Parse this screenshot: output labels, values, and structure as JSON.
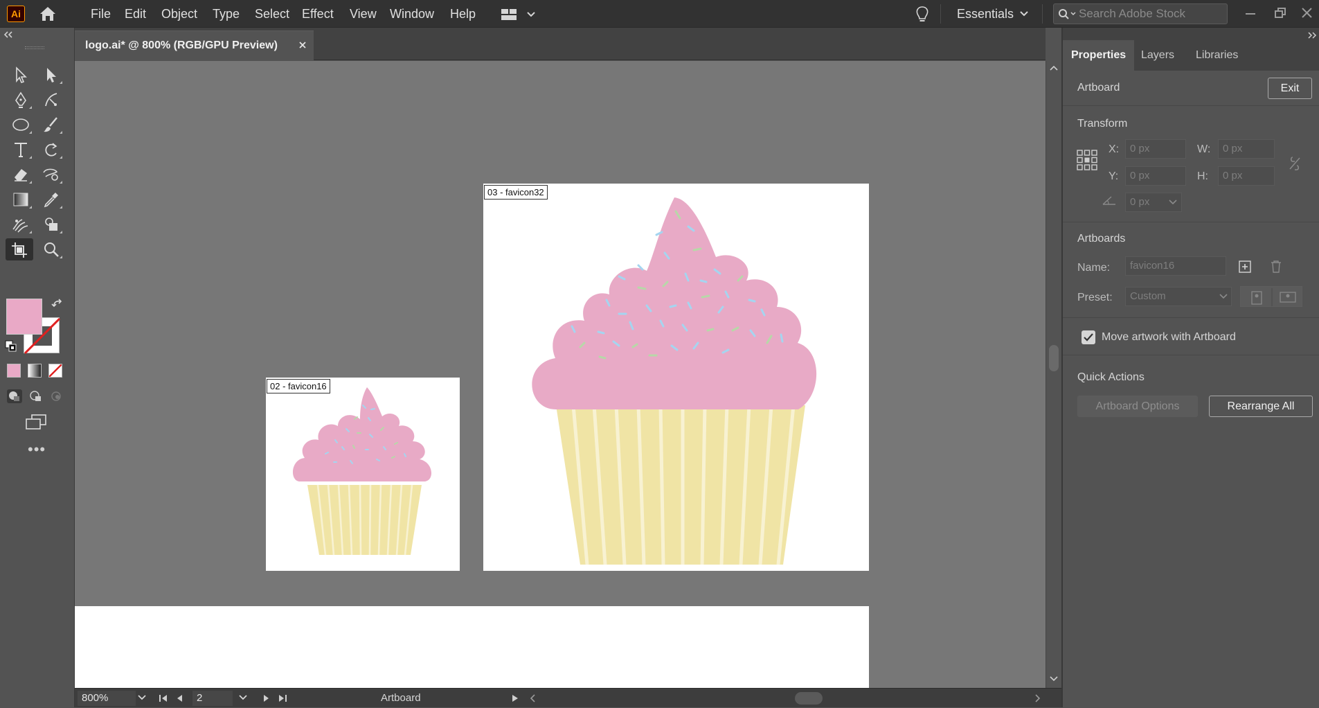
{
  "app": {
    "logo": "Ai",
    "menu": [
      "File",
      "Edit",
      "Object",
      "Type",
      "Select",
      "Effect",
      "View",
      "Window",
      "Help"
    ],
    "workspace": "Essentials",
    "stock_search_placeholder": "Search Adobe Stock"
  },
  "document": {
    "tab_title": "logo.ai* @ 800% (RGB/GPU Preview)",
    "close_glyph": "✕"
  },
  "toolbar": {
    "fill_color": "#e9a9c6",
    "stroke_color": "none",
    "more_glyph": "•••",
    "tools": [
      "selection-icon",
      "direct-selection-icon",
      "pen-icon",
      "curvature-icon",
      "ellipse-icon",
      "paintbrush-icon",
      "type-icon",
      "rotate-icon",
      "eraser-icon",
      "puppet-warp-icon",
      "gradient-icon",
      "eyedropper-icon",
      "blend-icon",
      "shape-builder-icon",
      "artboard-icon",
      "zoom-icon"
    ]
  },
  "canvas": {
    "artboards": [
      {
        "label": "02 - favicon16"
      },
      {
        "label": "03 - favicon32"
      }
    ],
    "colors": {
      "frosting": "#e8aac6",
      "wrapper": "#f0e4a5",
      "wrapper_stripe": "#f8f2d2",
      "background": "#777777"
    }
  },
  "status": {
    "zoom": "800%",
    "artboard_number": "2",
    "tool_name": "Artboard"
  },
  "panel": {
    "tabs": [
      "Properties",
      "Layers",
      "Libraries"
    ],
    "context": "Artboard",
    "exit_label": "Exit",
    "transform": {
      "title": "Transform",
      "x_label": "X:",
      "x_value": "0 px",
      "y_label": "Y:",
      "y_value": "0 px",
      "w_label": "W:",
      "w_value": "0 px",
      "h_label": "H:",
      "h_value": "0 px",
      "angle_value": "0 px"
    },
    "artboards": {
      "title": "Artboards",
      "name_label": "Name:",
      "name_value": "favicon16",
      "preset_label": "Preset:",
      "preset_value": "Custom"
    },
    "move_artwork_label": "Move artwork with Artboard",
    "quick_actions": {
      "title": "Quick Actions",
      "artboard_options": "Artboard Options",
      "rearrange_all": "Rearrange All"
    }
  }
}
